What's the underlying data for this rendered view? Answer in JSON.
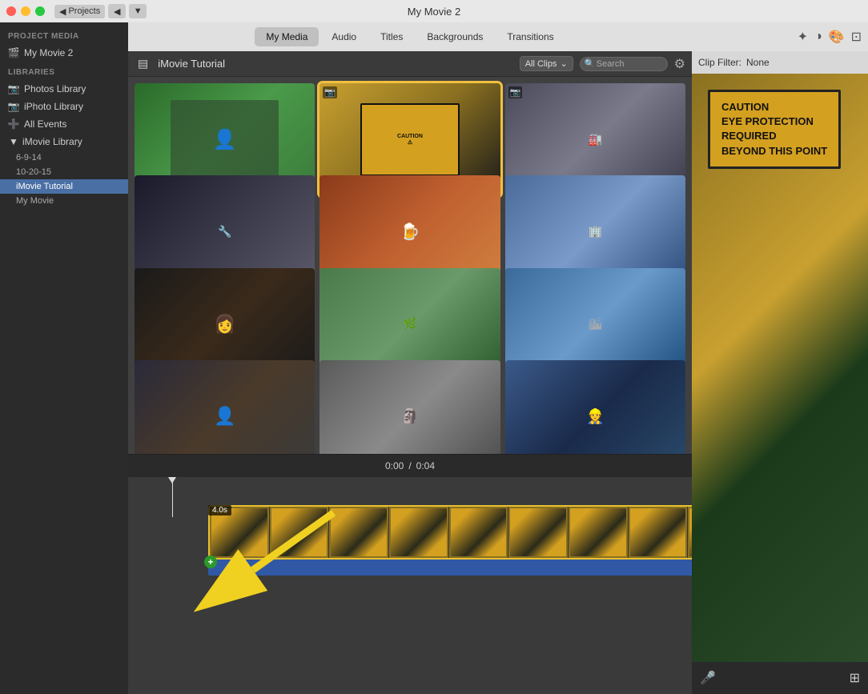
{
  "window": {
    "title": "My Movie 2",
    "traffic_lights": [
      "close",
      "minimize",
      "maximize"
    ]
  },
  "titlebar": {
    "title": "My Movie 2",
    "back_label": "Projects",
    "nav_left": "◀",
    "nav_right": "▶"
  },
  "top_tabs": {
    "items": [
      {
        "label": "My Media",
        "active": true
      },
      {
        "label": "Audio",
        "active": false
      },
      {
        "label": "Titles",
        "active": false
      },
      {
        "label": "Backgrounds",
        "active": false
      },
      {
        "label": "Transitions",
        "active": false
      }
    ]
  },
  "sidebar": {
    "project_media_label": "PROJECT MEDIA",
    "my_movie_label": "My Movie 2",
    "libraries_label": "LIBRARIES",
    "items": [
      {
        "label": "Photos Library",
        "icon": "📷"
      },
      {
        "label": "iPhoto Library",
        "icon": "📷"
      },
      {
        "label": "All Events",
        "icon": "➕"
      },
      {
        "label": "iMovie Library",
        "icon": "▼",
        "expanded": true
      },
      {
        "label": "6-9-14",
        "indent": true
      },
      {
        "label": "10-20-15",
        "indent": true
      },
      {
        "label": "iMovie Tutorial",
        "indent": true,
        "active": true
      },
      {
        "label": "My Movie",
        "indent": true
      }
    ]
  },
  "media_browser": {
    "title": "iMovie Tutorial",
    "filter_label": "All Clips",
    "search_placeholder": "Search",
    "thumbnails": [
      {
        "id": 1,
        "color_class": "thumb-bg-green",
        "selected": false
      },
      {
        "id": 2,
        "color_class": "thumb-bg-caution",
        "selected": true,
        "has_camera": true
      },
      {
        "id": 3,
        "color_class": "thumb-bg-factory",
        "selected": false,
        "has_camera": true
      },
      {
        "id": 4,
        "color_class": "thumb-bg-dark",
        "selected": false
      },
      {
        "id": 5,
        "color_class": "thumb-bg-mug",
        "selected": false
      },
      {
        "id": 6,
        "color_class": "thumb-bg-building",
        "selected": false
      },
      {
        "id": 7,
        "color_class": "thumb-bg-woman",
        "selected": false
      },
      {
        "id": 8,
        "color_class": "thumb-bg-exterior",
        "selected": false
      },
      {
        "id": 9,
        "color_class": "thumb-bg-office",
        "selected": false
      },
      {
        "id": 10,
        "color_class": "thumb-bg-person2",
        "selected": false
      },
      {
        "id": 11,
        "color_class": "thumb-bg-stone",
        "selected": false
      },
      {
        "id": 12,
        "color_class": "thumb-bg-worker",
        "selected": false
      }
    ]
  },
  "preview": {
    "clip_filter_label": "Clip Filter:",
    "clip_filter_value": "None",
    "caution_text": "CAUTION\nEYE PROTECTION\nREQUIRED\nBEYOND THIS POINT"
  },
  "timeline": {
    "time_current": "0:00",
    "time_total": "0:04",
    "clip_duration": "4.0s"
  },
  "icons": {
    "search": "🔍",
    "settings": "⚙",
    "toggle_sidebar": "▤",
    "mic": "🎤",
    "wand": "✦",
    "color": "◑",
    "crop": "⊡",
    "fit": "⊞"
  }
}
